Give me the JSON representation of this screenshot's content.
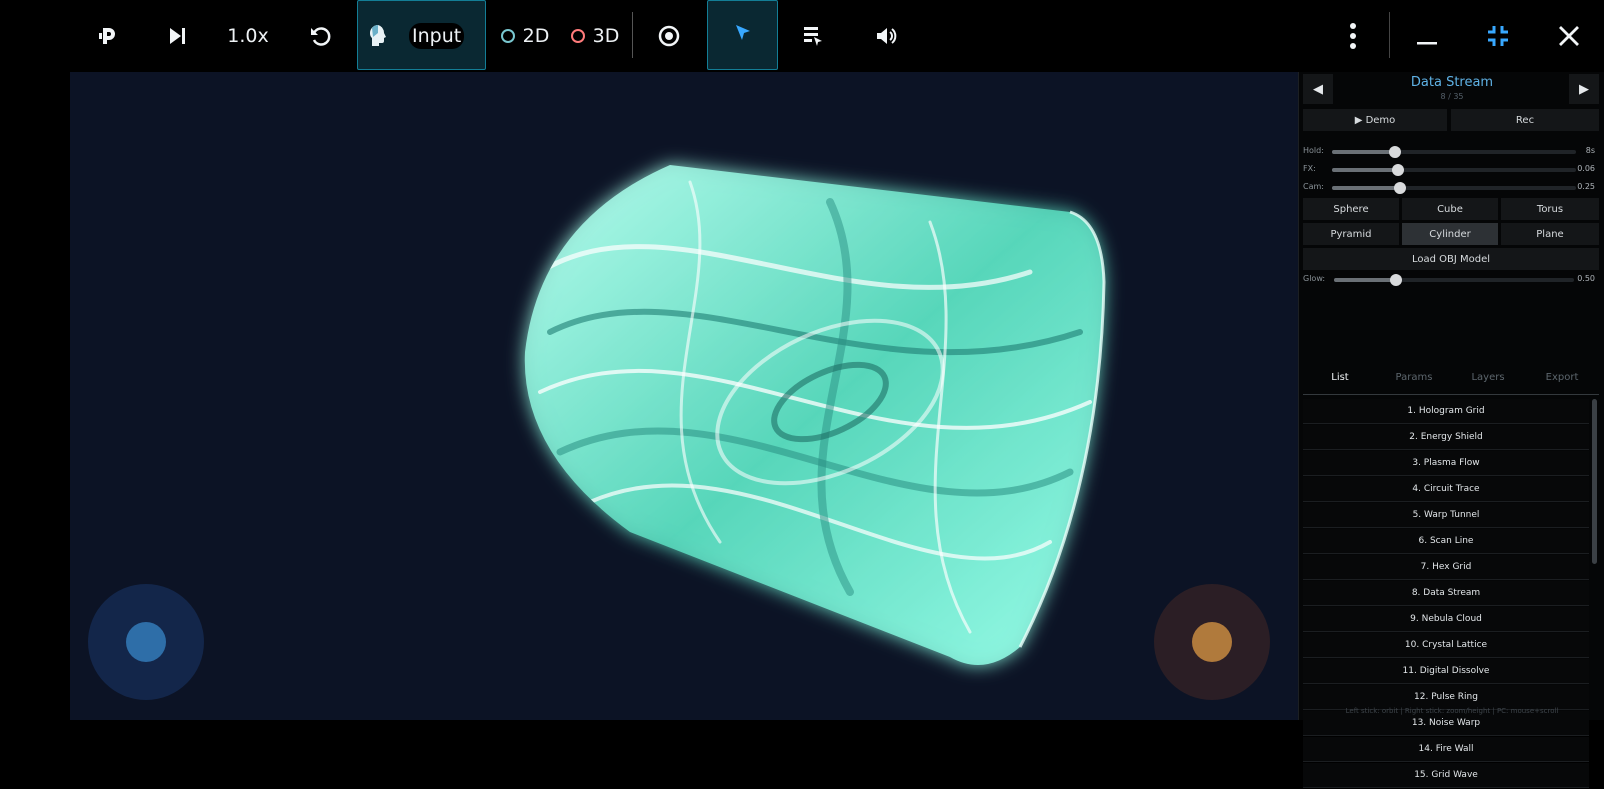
{
  "toolbar": {
    "speed_label": "1.0x",
    "input_label": "Input",
    "mode_2d_label": "2D",
    "mode_3d_label": "3D",
    "icons": [
      "app-logo-icon",
      "skip-next-icon",
      "reset-icon",
      "head-icon",
      "eye-icon",
      "pointer-icon",
      "checklist-icon",
      "volume-icon",
      "more-vert-icon",
      "minimize-icon",
      "exit-fullscreen-icon",
      "close-icon"
    ],
    "colors": {
      "accent": "#137e96",
      "ring_2d": "#79c7d0",
      "ring_3d": "#ff7b7b",
      "exit_fullscreen": "#38a8ff"
    }
  },
  "viewport": {
    "scene": "glowing-cylinder",
    "colors": {
      "background": "#0c1325",
      "glow": "#7affe6",
      "left_joystick": "#2e6ea8",
      "right_joystick": "#b07a3c"
    }
  },
  "panel": {
    "title": "Data Stream",
    "counter": "8 / 35",
    "demo_label": "▶ Demo",
    "rec_label": "Rec",
    "sliders": [
      {
        "label": "Hold:",
        "value": "8s",
        "fraction": 0.26
      },
      {
        "label": "FX:",
        "value": "0.06",
        "fraction": 0.27
      },
      {
        "label": "Cam:",
        "value": "0.25",
        "fraction": 0.28
      }
    ],
    "shapes": [
      "Sphere",
      "Cube",
      "Torus",
      "Pyramid",
      "Cylinder",
      "Plane"
    ],
    "active_shape": "Cylinder",
    "load_obj_label": "Load OBJ Model",
    "glow": {
      "label": "Glow:",
      "value": "0.50",
      "fraction": 0.26
    },
    "tabs": [
      "List",
      "Params",
      "Layers",
      "Export"
    ],
    "active_tab": "List",
    "effects": [
      "1. Hologram Grid",
      "2. Energy Shield",
      "3. Plasma Flow",
      "4. Circuit Trace",
      "5. Warp Tunnel",
      "6. Scan Line",
      "7. Hex Grid",
      "8. Data Stream",
      "9. Nebula Cloud",
      "10. Crystal Lattice",
      "11. Digital Dissolve",
      "12. Pulse Ring",
      "13. Noise Warp",
      "14. Fire Wall",
      "15. Grid Wave"
    ],
    "hint": "Left stick: orbit | Right stick: zoom/height | PC: mouse+scroll",
    "colors": {
      "title": "#5fb2e6"
    }
  }
}
